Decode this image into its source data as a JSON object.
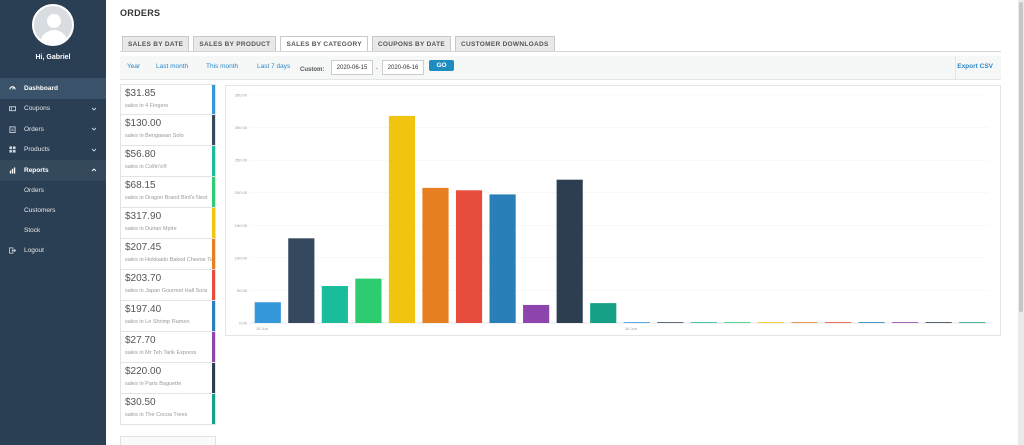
{
  "sidebar": {
    "greeting": "Hi, Gabriel",
    "nav": [
      {
        "label": "Dashboard",
        "icon": "dashboard-icon"
      },
      {
        "label": "Coupons",
        "icon": "ticket-icon"
      },
      {
        "label": "Orders",
        "icon": "clipboard-icon"
      },
      {
        "label": "Products",
        "icon": "grid-icon"
      },
      {
        "label": "Reports",
        "icon": "bar-chart-icon"
      }
    ],
    "reports_sub": [
      {
        "label": "Orders"
      },
      {
        "label": "Customers"
      },
      {
        "label": "Stock"
      }
    ],
    "logout": {
      "label": "Logout",
      "icon": "logout-icon"
    }
  },
  "page": {
    "title": "ORDERS"
  },
  "tabs": [
    {
      "label": "SALES BY DATE"
    },
    {
      "label": "SALES BY PRODUCT"
    },
    {
      "label": "SALES BY CATEGORY"
    },
    {
      "label": "COUPONS BY DATE"
    },
    {
      "label": "CUSTOMER DOWNLOADS"
    }
  ],
  "range": {
    "links": [
      "Year",
      "Last month",
      "This month",
      "Last 7 days"
    ],
    "custom_label": "Custom:",
    "start_date": "2020-06-15",
    "end_date": "2020-06-16",
    "separator": "-",
    "go_label": "GO",
    "export_label": "Export CSV"
  },
  "legend": [
    {
      "amount": "$31.85",
      "label": "sales in 4 Fingers",
      "color": "#3498db"
    },
    {
      "amount": "$130.00",
      "label": "sales in Bengawan Solo",
      "color": "#34495e"
    },
    {
      "amount": "$56.80",
      "label": "sales in Collin's®",
      "color": "#1abc9c"
    },
    {
      "amount": "$68.15",
      "label": "sales in Dragon Brand Bird's Nest",
      "color": "#2ecc71"
    },
    {
      "amount": "$317.90",
      "label": "sales in Durian Mpire",
      "color": "#f1c40f"
    },
    {
      "amount": "$207.45",
      "label": "sales in Hokkaido Baked Cheese Tart",
      "color": "#e67e22"
    },
    {
      "amount": "$203.70",
      "label": "sales in Japan Gourmet Hall Sora",
      "color": "#e74c3c"
    },
    {
      "amount": "$197.40",
      "label": "sales in Le Shrimp Ramen",
      "color": "#2980b9"
    },
    {
      "amount": "$27.70",
      "label": "sales in Mr Teh Tarik Express",
      "color": "#8e44ad"
    },
    {
      "amount": "$220.00",
      "label": "sales in Paris Baguette",
      "color": "#2c3e50"
    },
    {
      "amount": "$30.50",
      "label": "sales in The Cocoa Trees",
      "color": "#16a085"
    }
  ],
  "chart_data": {
    "type": "bar",
    "categories": [
      "15 Jun",
      "16 Jun"
    ],
    "ylim": [
      0,
      350
    ],
    "yticks": [
      "0.00",
      "50.00",
      "100.00",
      "150.00",
      "200.00",
      "250.00",
      "300.00",
      "350.00"
    ],
    "series": [
      {
        "name": "4 Fingers",
        "color": "#3498db",
        "values": [
          31.85,
          0
        ]
      },
      {
        "name": "Bengawan Solo",
        "color": "#34495e",
        "values": [
          130.0,
          0
        ]
      },
      {
        "name": "Collin's®",
        "color": "#1abc9c",
        "values": [
          56.8,
          0
        ]
      },
      {
        "name": "Dragon Brand Bird's Nest",
        "color": "#2ecc71",
        "values": [
          68.15,
          0
        ]
      },
      {
        "name": "Durian Mpire",
        "color": "#f1c40f",
        "values": [
          317.9,
          0
        ]
      },
      {
        "name": "Hokkaido Baked Cheese Tart",
        "color": "#e67e22",
        "values": [
          207.45,
          0
        ]
      },
      {
        "name": "Japan Gourmet Hall Sora",
        "color": "#e74c3c",
        "values": [
          203.7,
          0
        ]
      },
      {
        "name": "Le Shrimp Ramen",
        "color": "#2980b9",
        "values": [
          197.4,
          0
        ]
      },
      {
        "name": "Mr Teh Tarik Express",
        "color": "#8e44ad",
        "values": [
          27.7,
          0
        ]
      },
      {
        "name": "Paris Baguette",
        "color": "#2c3e50",
        "values": [
          220.0,
          0
        ]
      },
      {
        "name": "The Cocoa Trees",
        "color": "#16a085",
        "values": [
          30.5,
          0
        ]
      }
    ]
  }
}
